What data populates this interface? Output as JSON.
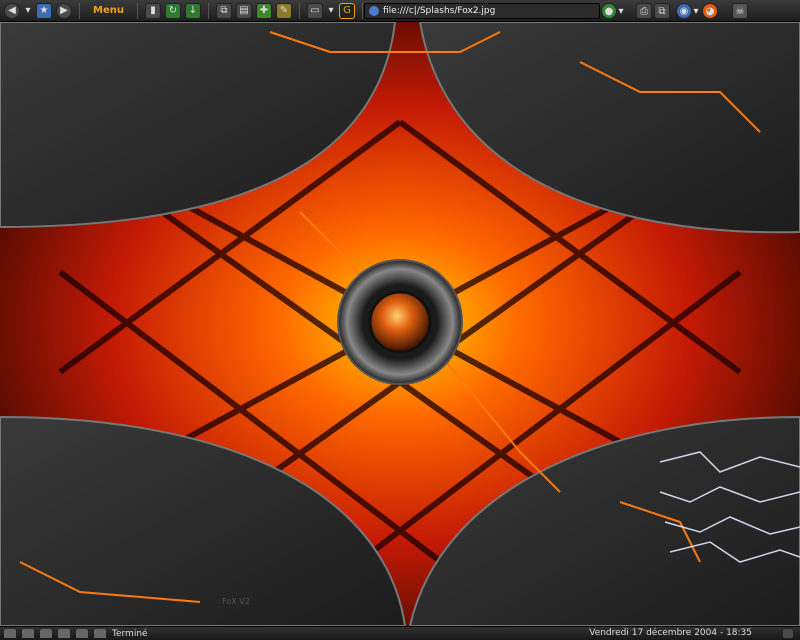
{
  "toolbar": {
    "menu_label": "Menu",
    "icons": [
      "back-icon",
      "forward-icon",
      "home-icon",
      "reload-icon",
      "download-icon",
      "copy-icon",
      "paste-icon",
      "puzzle-icon",
      "edit-icon",
      "page-icon",
      "g-icon",
      "mail-icon",
      "globe-icon",
      "go-icon",
      "print-icon",
      "search-icon",
      "firefox-icon",
      "skull-icon"
    ]
  },
  "address": {
    "url": "file:///c|/Splashs/Fox2.jpg"
  },
  "page": {
    "watermark": "FoX V2"
  },
  "statusbar": {
    "status": "Terminé",
    "datetime": "Vendredi 17 décembre 2004 - 18:35"
  },
  "colors": {
    "accent": "#f0a020",
    "fire_red": "#c41a05",
    "fire_orange": "#ff6a00",
    "fire_yellow": "#ffd200",
    "panel": "#2a2a2a"
  }
}
